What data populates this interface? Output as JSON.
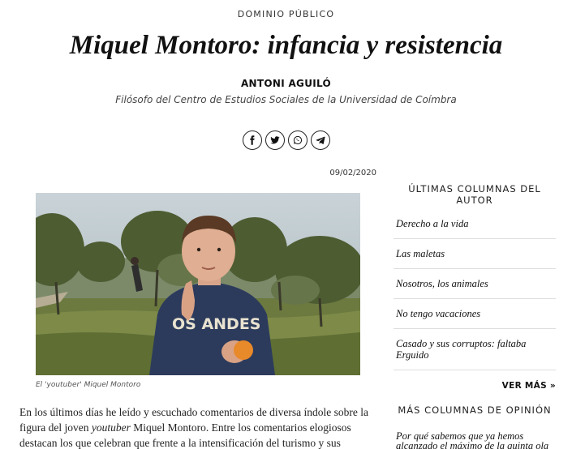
{
  "section": {
    "label": "DOMINIO PÚBLICO"
  },
  "article": {
    "title": "Miquel Montoro: infancia y resistencia",
    "author_name": "ANTONI AGUILÓ",
    "author_role": "Filósofo del Centro de Estudios Sociales de la Universidad de Coímbra",
    "date": "09/02/2020",
    "photo_caption": "El 'youtuber' Miquel Montoro",
    "photo_shirt_text": "OS ANDES",
    "body_line1": "En los últimos días he leído y escuchado comentarios de diversa índole sobre la",
    "body_line2_pre": "figura del joven ",
    "body_line2_em": "youtuber",
    "body_line2_post": " Miquel Montoro. Entre los comentarios elogiosos",
    "body_line3": "destacan los que celebran que frente a la intensificación del turismo y sus"
  },
  "share": {
    "buttons": [
      {
        "icon": "facebook-icon"
      },
      {
        "icon": "twitter-icon"
      },
      {
        "icon": "whatsapp-icon"
      },
      {
        "icon": "telegram-icon"
      }
    ]
  },
  "sidebar": {
    "author_heading": "ÚLTIMAS COLUMNAS DEL AUTOR",
    "author_items": [
      "Derecho a la vida",
      "Las maletas",
      "Nosotros, los animales",
      "No tengo vacaciones",
      "Casado y sus corruptos: faltaba Erguido"
    ],
    "see_more": "VER MÁS »",
    "opinion_heading": "MÁS COLUMNAS DE OPINIÓN",
    "opinion_first_item": "Por qué sabemos que ya hemos alcanzado el máximo de la quinta ola"
  }
}
